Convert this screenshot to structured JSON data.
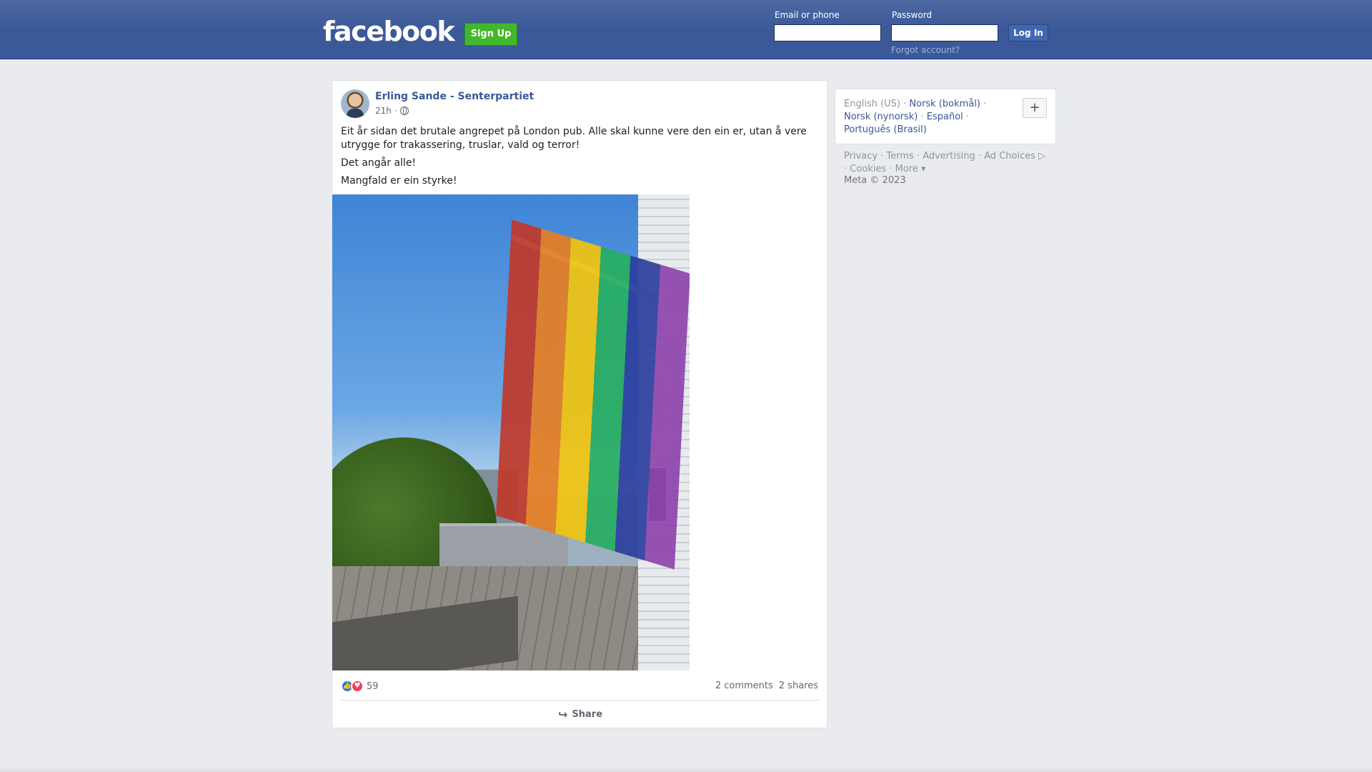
{
  "header": {
    "logo": "facebook",
    "signup_label": "Sign Up",
    "email_label": "Email or phone",
    "password_label": "Password",
    "login_label": "Log In",
    "forgot_label": "Forgot account?"
  },
  "post": {
    "author": "Erling Sande - Senterpartiet",
    "time": "21h",
    "visibility_icon": "globe-icon",
    "paragraphs": [
      "Eit år sidan det brutale angrepet på London pub. Alle skal kunne vere den ein er, utan å vere utrygge for trakassering, truslar, vald og terror!",
      "Det angår alle!",
      "Mangfald er ein styrke!"
    ],
    "reaction_count": "59",
    "comments": "2 comments",
    "shares": "2 shares",
    "share_label": "Share"
  },
  "sidebar": {
    "languages": [
      "English (US)",
      "Norsk (bokmål)",
      "Norsk (nynorsk)",
      "Español",
      "Português (Brasil)"
    ],
    "plus_label": "+",
    "footer_links": [
      "Privacy",
      "Terms",
      "Advertising",
      "Ad Choices",
      "Cookies",
      "More"
    ],
    "copyright": "Meta © 2023"
  },
  "colors": {
    "header_bg": "#3b5998",
    "link": "#385898",
    "signup_green": "#42b72a"
  }
}
